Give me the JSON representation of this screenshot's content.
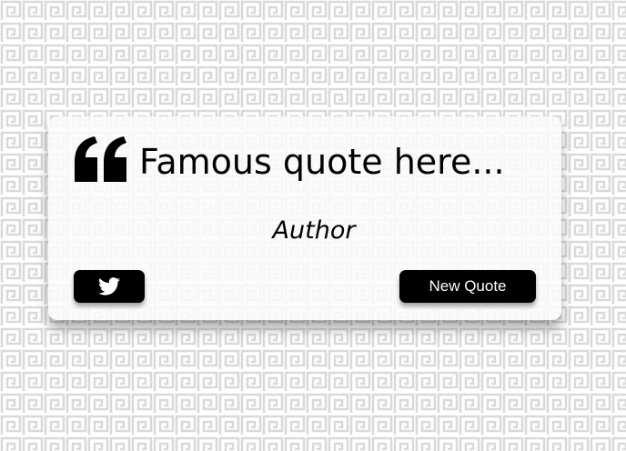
{
  "quote": {
    "text": "Famous quote here...",
    "author": "Author"
  },
  "buttons": {
    "tweet_icon": "twitter-icon",
    "new_quote_label": "New Quote"
  },
  "colors": {
    "card_background": "#fafafa",
    "button_background": "#000000",
    "button_text": "#ffffff",
    "pattern_stroke": "#d9d9d9"
  },
  "icons": {
    "quote_mark": "quote-left-icon"
  }
}
